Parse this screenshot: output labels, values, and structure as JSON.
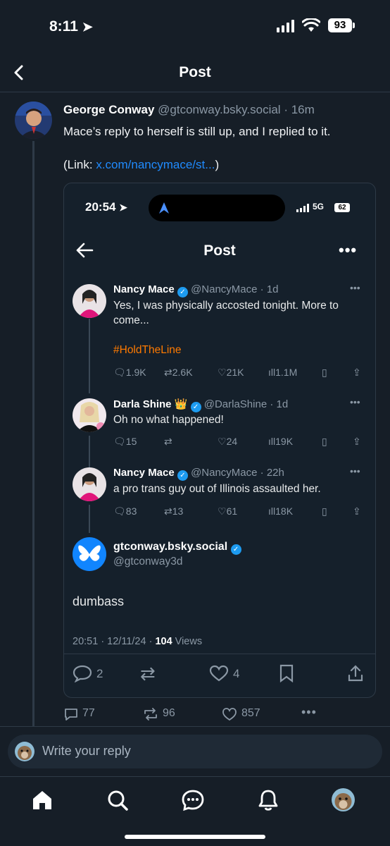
{
  "status_bar": {
    "time": "8:11",
    "battery": "93"
  },
  "header": {
    "title": "Post"
  },
  "post": {
    "author_name": "George Conway",
    "author_handle": "@gtconway.bsky.social",
    "time_sep": "·",
    "age": "16m",
    "text": "Mace’s reply to herself is still up, and I replied to it.",
    "link_prefix": "(Link:",
    "link_text": "x.com/nancymace/st...",
    "link_suffix": ")",
    "counts": {
      "replies": "77",
      "reposts": "96",
      "likes": "857"
    }
  },
  "embed": {
    "status_time": "20:54",
    "signal_label": "5G",
    "battery": "62",
    "title": "Post",
    "tweets": [
      {
        "name": "Nancy Mace",
        "handle": "@NancyMace · 1d",
        "text": "Yes, I was physically accosted tonight. More to come...",
        "hashtag": "#HoldTheLine",
        "replies": "1.9K",
        "reposts": "2.6K",
        "likes": "21K",
        "views": "1.1M"
      },
      {
        "name": "Darla Shine",
        "badge": "👑",
        "handle": "@DarlaShine · 1d",
        "text": "Oh no what happened!",
        "replies": "15",
        "reposts": "",
        "likes": "24",
        "views": "19K"
      },
      {
        "name": "Nancy Mace",
        "handle": "@NancyMace · 22h",
        "text": "a pro trans guy out of Illinois assaulted her.",
        "replies": "83",
        "reposts": "13",
        "likes": "61",
        "views": "18K"
      }
    ],
    "main": {
      "name": "gtconway.bsky.social",
      "handle": "@gtconway3d",
      "text": "dumbass",
      "meta_prefix": "20:51 · 12/11/24 · ",
      "views_count": "104",
      "views_label": " Views",
      "replies": "2",
      "likes": "4"
    }
  },
  "reply_bar": {
    "placeholder": "Write your reply"
  },
  "nav": [
    "home-icon",
    "search-icon",
    "chat-icon",
    "bell-icon",
    "profile-avatar"
  ]
}
